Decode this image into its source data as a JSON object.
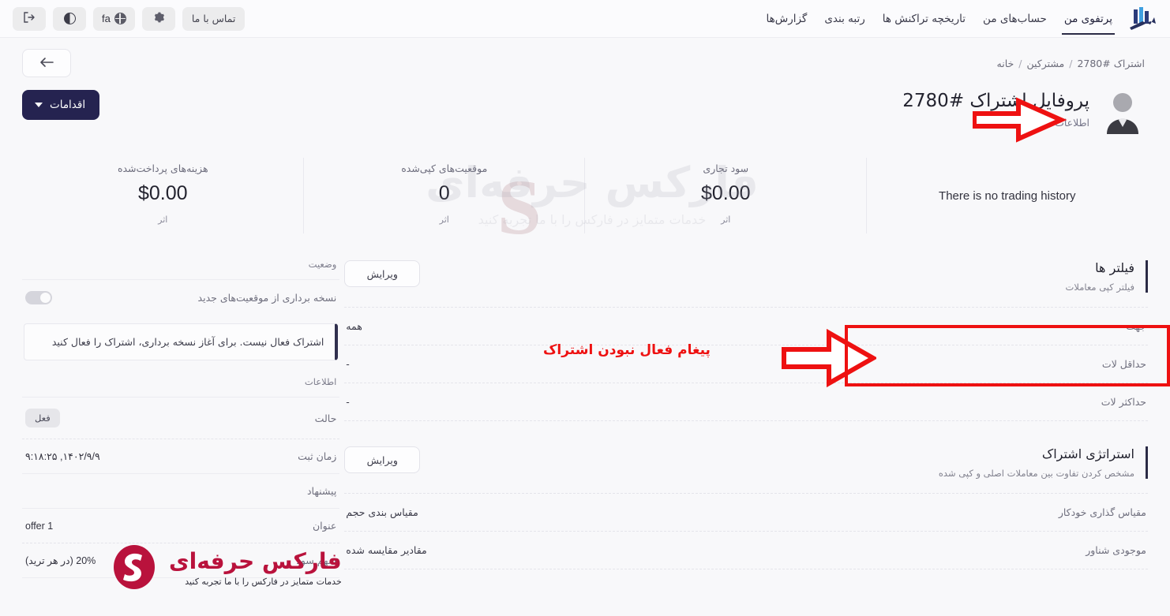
{
  "nav": {
    "logo_icon": "bar-chart-arrow-logo",
    "items": [
      {
        "label": "پرتفوی من",
        "active": true
      },
      {
        "label": "حساب‌های من",
        "active": false
      },
      {
        "label": "تاریخچه تراکنش ها",
        "active": false
      },
      {
        "label": "رتبه بندی",
        "active": false
      },
      {
        "label": "گزارش‌ها",
        "active": false
      }
    ],
    "contact_label": "تماس با ما",
    "settings_icon": "gear-icon",
    "lang_icon": "globe-icon",
    "lang_label": "fa",
    "theme_icon": "half-circle-icon",
    "logout_icon": "logout-icon"
  },
  "breadcrumb": {
    "home": "خانه",
    "sep": "/",
    "subscribers": "مشترکین",
    "current": "اشتراک #2780",
    "back_icon": "arrow-left-icon"
  },
  "profile": {
    "avatar_icon": "user-avatar-icon",
    "title": "پروفایل اشتراک #2780",
    "subtitle": "اطلاعات کلی درباره اشتراک",
    "actions_label": "اقدامات",
    "actions_icon": "chevron-down-icon"
  },
  "stats": {
    "paid_fees": {
      "label": "هزینه‌های پرداخت‌شده",
      "value": "$0.00",
      "unit": "اثر"
    },
    "copied_positions": {
      "label": "موقعیت‌های کپی‌شده",
      "value": "0",
      "unit": "اثر"
    },
    "trading_profit": {
      "label": "سود تجاری",
      "value": "$0.00",
      "unit": "اثر"
    },
    "empty_message": "There is no trading history"
  },
  "watermark": {
    "main": "فارکس حرفه‌ای",
    "sub": "خدمات متمایز در فارکس را با ما تجربه کنید",
    "letter": "S"
  },
  "filters": {
    "title": "فیلتر ها",
    "subtitle": "فیلتر کپی معاملات",
    "edit_label": "ویرایش",
    "rows": [
      {
        "key": "جهت",
        "value": "همه"
      },
      {
        "key": "حداقل لات",
        "value": "-"
      },
      {
        "key": "حداکثر لات",
        "value": "-"
      }
    ]
  },
  "strategy": {
    "title": "استراتژی اشتراک",
    "subtitle": "مشخص کردن تفاوت بین معاملات اصلی و کپی شده",
    "edit_label": "ویرایش",
    "rows": [
      {
        "key": "مقیاس گذاری خودکار",
        "value": "مقیاس بندی حجم"
      },
      {
        "key": "موجودی شناور",
        "value": "مقادیر مقایسه شده"
      }
    ]
  },
  "sidepanel": {
    "status_label": "وضعیت",
    "copy_new_positions": {
      "label": "نسخه برداری از موقعیت‌های جدید",
      "toggle": "off"
    },
    "alert_text": "اشتراک فعال نیست. برای آغاز نسخه برداری، اشتراک را فعال کنید",
    "info_label": "اطلاعات",
    "info_rows": [
      {
        "key": "حالت",
        "value": "فعل",
        "is_badge": true
      },
      {
        "key": "زمان ثبت",
        "value": "۱۴۰۲/۹/۹, ۹:۱۸:۲۵",
        "is_badge": false
      }
    ],
    "offer_label": "پیشنهاد",
    "offer_rows": [
      {
        "key": "عنوان",
        "value": "offer 1"
      },
      {
        "key": "سهم سود",
        "value": "20% (در هر ترید)"
      }
    ]
  },
  "annotations": {
    "inactive_message": "پیغام فعال نبودن اشتراک",
    "arrow_color": "#ee1111"
  }
}
